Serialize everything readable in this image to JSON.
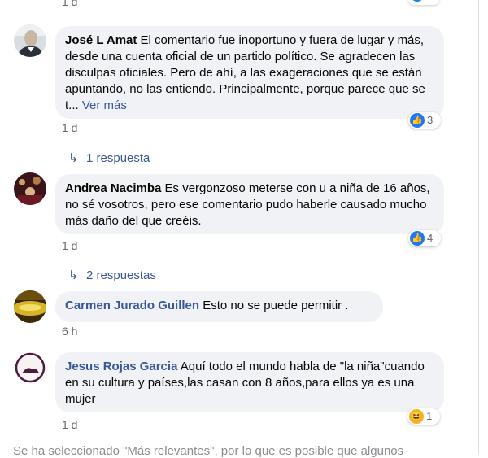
{
  "comments": [
    {
      "author": "José L Amat",
      "text": "El comentario fue inoportuno y fuera de lugar y más, desde una cuenta oficial de un partido político. Se agradecen las disculpas oficiales. Pero de ahí, a las exageraciones que se están apuntando, no las entiendo. Principalmente, porque parece que se t...",
      "see_more": "Ver más",
      "time": "1 d",
      "reaction_count": "3",
      "reaction_icon": "like-icon",
      "replies": "1 respuesta"
    },
    {
      "author": "Andrea Nacimba",
      "text": "Es vergonzoso meterse con u a niña de 16 años, no sé vosotros, pero ese comentario pudo haberle causado mucho más daño del que creéis.",
      "time": "1 d",
      "reaction_count": "4",
      "reaction_icon": "like-icon",
      "replies": "2 respuestas"
    },
    {
      "author": "Carmen Jurado Guillen",
      "text": "Esto no se puede permitir .",
      "time": "6 h"
    },
    {
      "author": "Jesus Rojas Garcia",
      "text": "Aquí todo el mundo habla de \"la niña\"cuando en su cultura y países,las casan con 8 años,para ellos ya es una mujer",
      "time": "1 d",
      "reaction_count": "1",
      "reaction_icon": "haha-icon"
    }
  ],
  "top_time": "1 d",
  "footer_text": "Se ha seleccionado \"Más relevantes\", por lo que es posible que algunos",
  "colors": {
    "link": "#385898",
    "bubble": "#f0f2f5",
    "like": "#2078f4"
  }
}
